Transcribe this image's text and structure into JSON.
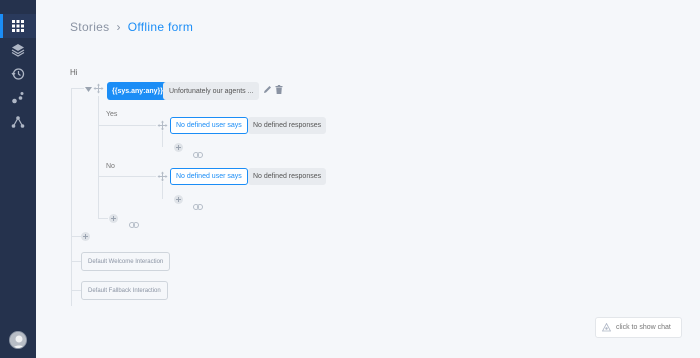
{
  "breadcrumb": {
    "root": "Stories",
    "separator": "›",
    "current": "Offline form"
  },
  "story": {
    "intent_title": "Hi"
  },
  "root_node": {
    "condition": "{{sys.any:any}}",
    "response": "Unfortunately our agents ..."
  },
  "branches": [
    {
      "label": "Yes",
      "user_says": "No defined user says",
      "responses": "No defined responses"
    },
    {
      "label": "No",
      "user_says": "No defined user says",
      "responses": "No defined responses"
    }
  ],
  "stories": [
    {
      "label": "Default Welcome Interaction"
    },
    {
      "label": "Default Fallback Interaction"
    }
  ],
  "chat": {
    "label": "click to show chat"
  },
  "icons": {
    "nav": [
      "grid-icon",
      "layers-icon",
      "history-icon",
      "entities-icon",
      "graph-icon"
    ],
    "edit": "pencil-icon",
    "delete": "trash-icon"
  },
  "colors": {
    "accent": "#1b8df6",
    "sidebar": "#25324d",
    "background": "#f5f7fa"
  }
}
